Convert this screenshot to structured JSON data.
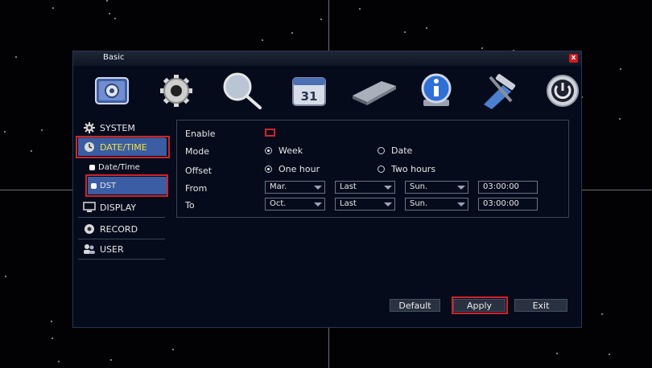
{
  "window": {
    "title": "Basic",
    "close_label": "x"
  },
  "toolbar": {
    "icons": [
      "system-settings-icon",
      "gear-icon",
      "magnifier-icon",
      "calendar-icon",
      "hard-drive-icon",
      "info-icon",
      "tools-icon",
      "power-icon"
    ],
    "calendar_text": "31"
  },
  "sidebar": {
    "items": [
      {
        "label": "SYSTEM",
        "icon": "gear-icon"
      },
      {
        "label": "DATE/TIME",
        "icon": "clock-icon",
        "active": true
      },
      {
        "label": "Date/Time",
        "sub": true
      },
      {
        "label": "DST",
        "sub": true,
        "selected": true
      },
      {
        "label": "DISPLAY",
        "icon": "monitor-icon"
      },
      {
        "label": "RECORD",
        "icon": "record-icon"
      },
      {
        "label": "USER",
        "icon": "users-icon"
      }
    ]
  },
  "form": {
    "enable_label": "Enable",
    "mode_label": "Mode",
    "mode_week": "Week",
    "mode_date": "Date",
    "offset_label": "Offset",
    "offset_one": "One hour",
    "offset_two": "Two hours",
    "from_label": "From",
    "to_label": "To",
    "from": {
      "month": "Mar.",
      "week": "Last",
      "day": "Sun.",
      "time": "03:00:00"
    },
    "to": {
      "month": "Oct.",
      "week": "Last",
      "day": "Sun.",
      "time": "03:00:00"
    }
  },
  "buttons": {
    "default": "Default",
    "apply": "Apply",
    "exit": "Exit"
  },
  "colors": {
    "highlight": "#d0242b",
    "active_bg": "#3a5da3",
    "dialog_bg": "#050b1b"
  }
}
